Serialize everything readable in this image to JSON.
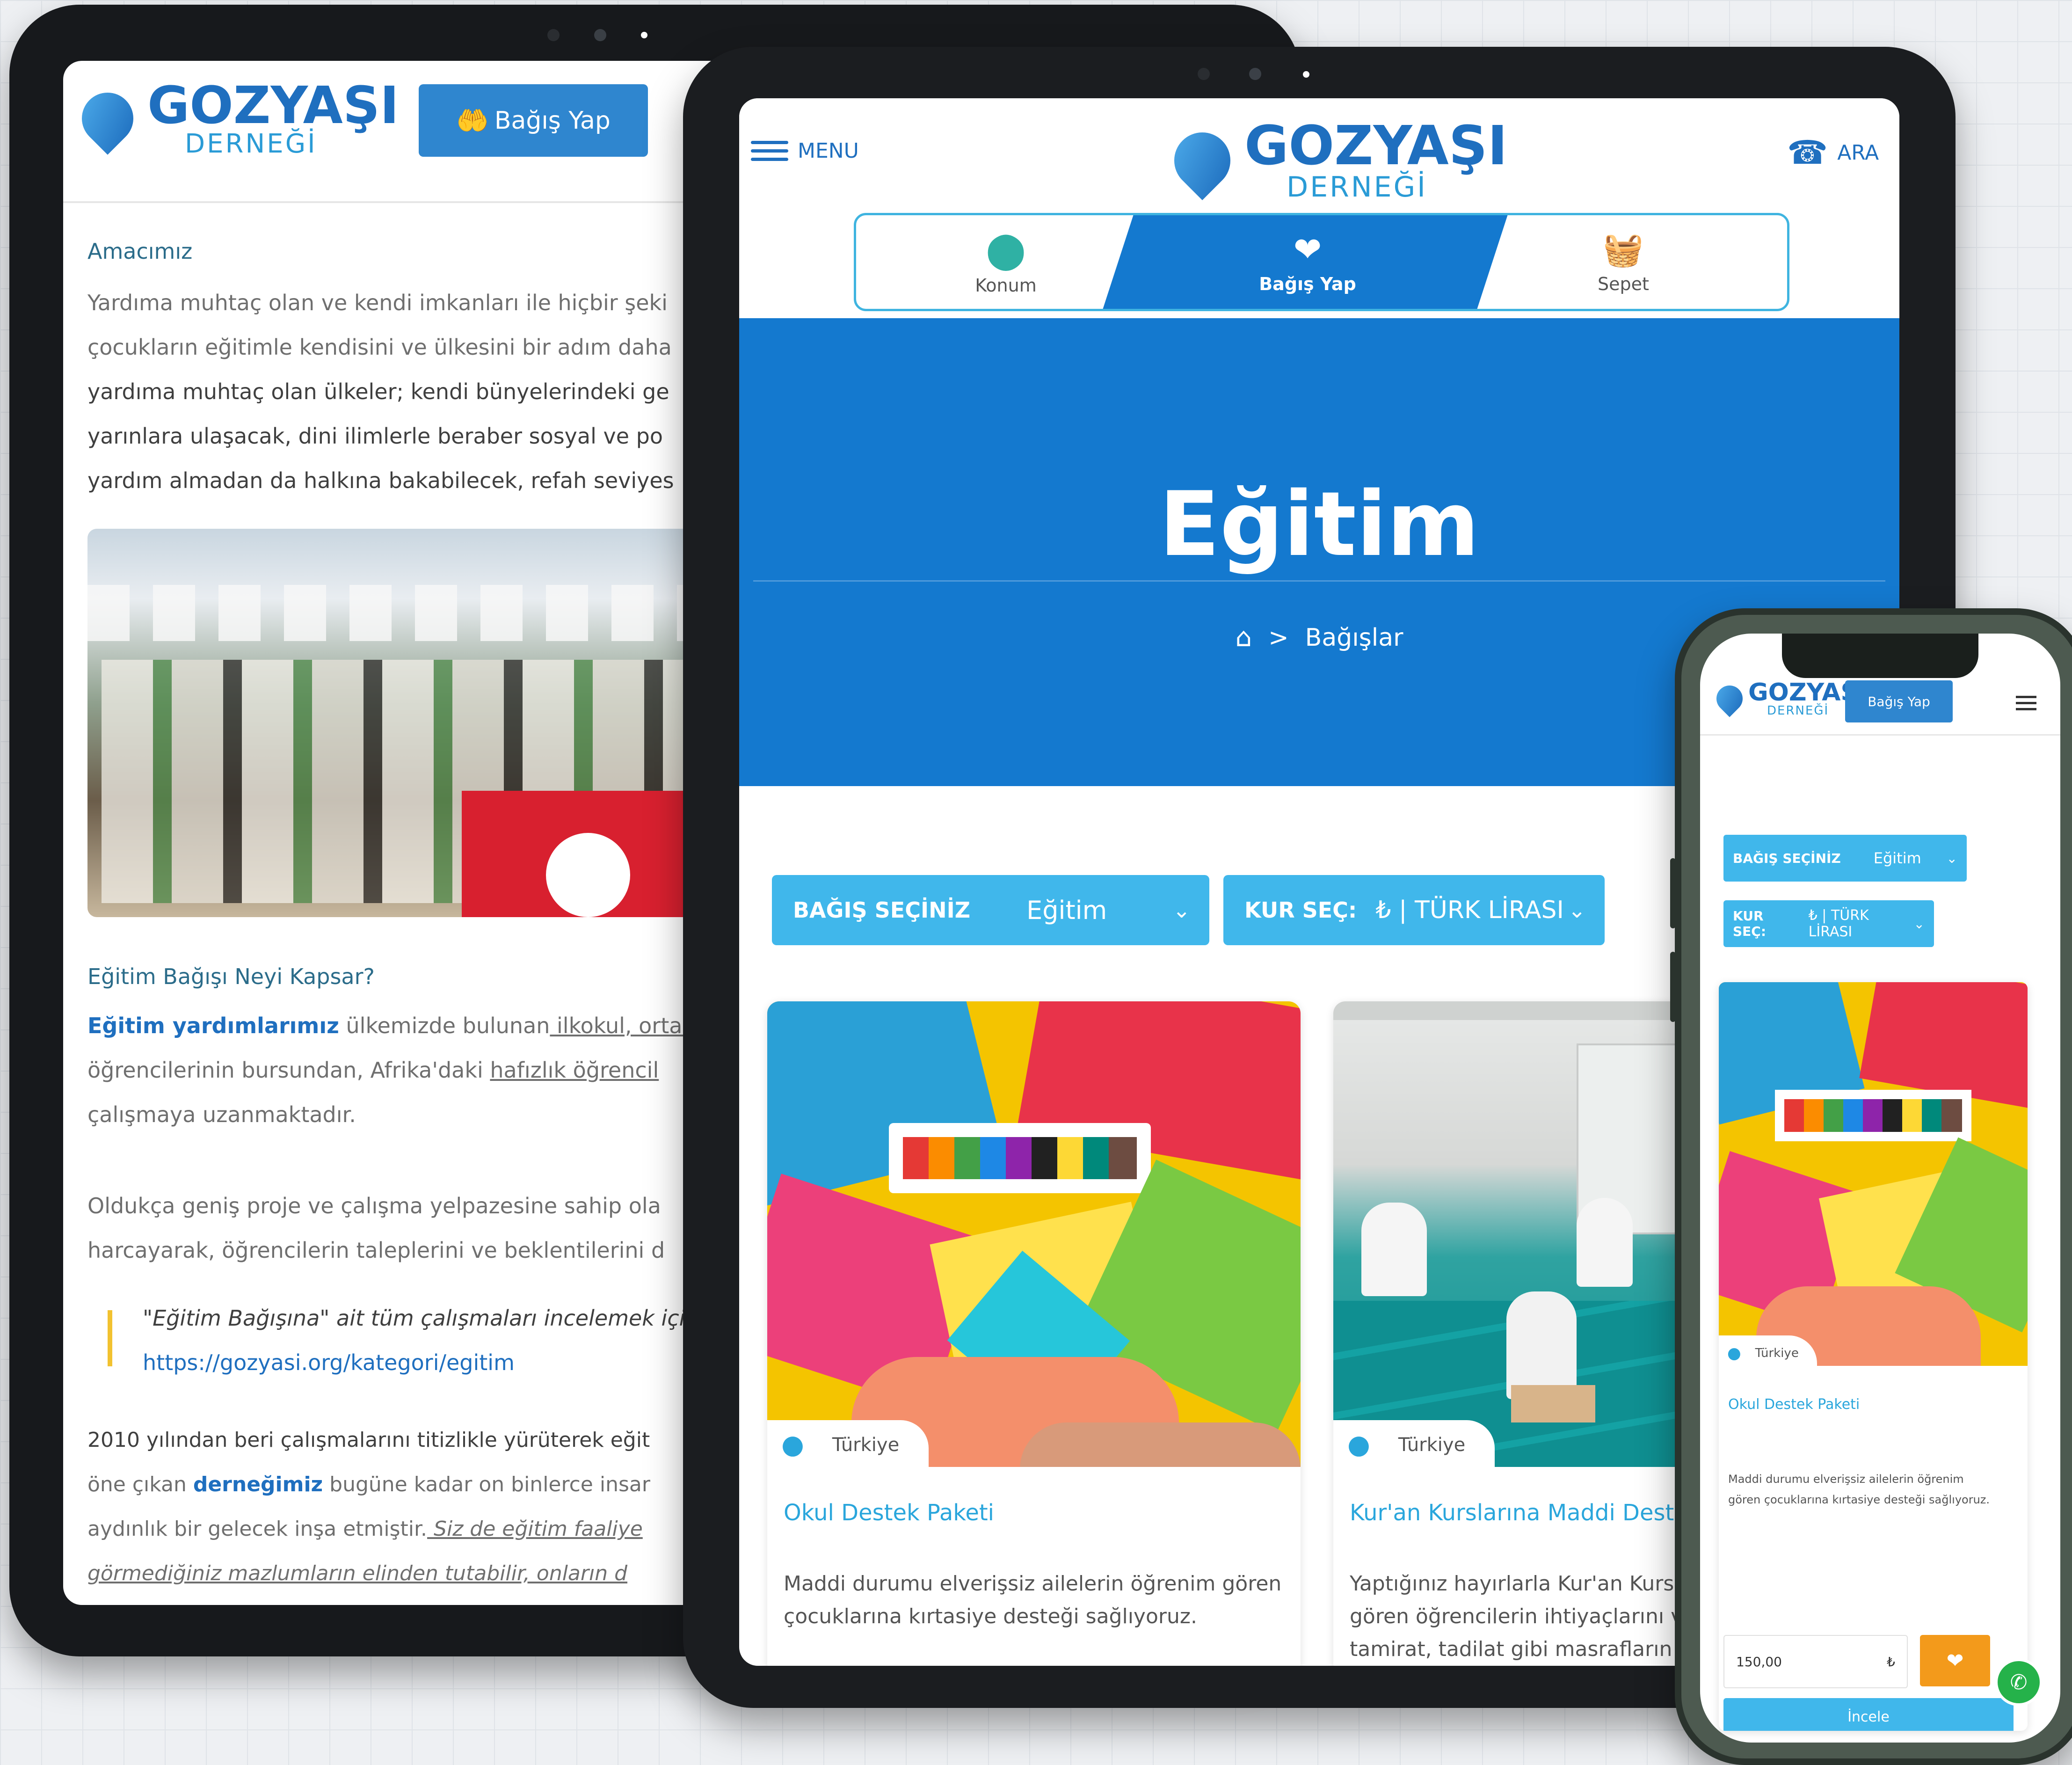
{
  "brand": {
    "name": "GOZYAŞI",
    "sub": "DERNEĞİ"
  },
  "colors": {
    "primary": "#1479cf",
    "accent": "#40b7eb",
    "link": "#2aa6dc",
    "orange": "#f39a1b",
    "quote_bar": "#f2c230"
  },
  "tablet_left": {
    "donate_button": "Bağış Yap",
    "heading_aim": "Amacımız",
    "aim_lines": [
      "Yardıma muhtaç olan ve kendi imkanları ile hiçbir şeki",
      "çocukların eğitimle kendisini ve ülkesini bir adım daha",
      "yardıma muhtaç olan ülkeler; kendi bünyelerindeki ge",
      "yarınlara ulaşacak, dini ilimlerle beraber sosyal ve po",
      "yardım almadan da halkına bakabilecek, refah seviyes"
    ],
    "heading_scope": "Eğitim Bağışı Neyi Kapsar?",
    "scope_lines": {
      "l1_bold": "Eğitim yardımlarımız",
      "l1_rest": " ülkemizde bulunan",
      "l1_link": " ilkokul, ortao",
      "l2_start": "öğrencilerinin bursundan, Afrika'daki ",
      "l2_link": "hafızlık öğrencil",
      "l3": "çalışmaya uzanmaktadır."
    },
    "para2_lines": [
      "Oldukça geniş proje ve çalışma yelpazesine sahip ola",
      "harcayarak, öğrencilerin taleplerini ve beklentilerini d"
    ],
    "quote_text": "\"Eğitim Bağışına\" ait tüm çalışmaları incelemek içi",
    "quote_link": "https://gozyasi.org/kategori/egitim",
    "para3_l1": "2010 yılından beri çalışmalarını titizlikle yürüterek eğit",
    "para3_l2_start": "öne çıkan ",
    "para3_l2_bold": "derneğimiz",
    "para3_l2_rest": " bugüne kadar on binlerce insar",
    "para3_l3_start": "aydınlık bir gelecek inşa etmiştir.",
    "para3_l3_link": " Siz de eğitim faaliye",
    "para3_l4_link": "görmediğiniz mazlumların elinden tutabilir, onların d"
  },
  "tablet_center": {
    "menu_label": "MENU",
    "call_label": "ARA",
    "tabs": [
      {
        "label": "Konum",
        "icon": "location-pin-icon"
      },
      {
        "label": "Bağış Yap",
        "icon": "donate-hand-icon"
      },
      {
        "label": "Sepet",
        "icon": "basket-icon"
      }
    ],
    "hero_title": "Eğitim",
    "breadcrumb_sep": ">",
    "breadcrumb_current": "Bağışlar",
    "donation_select_label": "BAĞIŞ SEÇİNİZ",
    "donation_select_value": "Eğitim",
    "currency_select_label": "KUR SEÇ:",
    "currency_select_value": "₺ | TÜRK LİRASI",
    "cards": [
      {
        "location": "Türkiye",
        "title": "Okul Destek Paketi",
        "text_l1": "Maddi durumu elverişsiz ailelerin öğrenim gören",
        "text_l2": "çocuklarına kırtasiye desteği sağlıyoruz."
      },
      {
        "location": "Türkiye",
        "title": "Kur'an Kurslarına Maddi Deste",
        "text_l1": "Yaptığınız hayırlarla Kur'an Kursla",
        "text_l2": "gören öğrencilerin ihtiyaçlarını v",
        "text_l3": "tamirat, tadilat gibi masrafların"
      }
    ]
  },
  "phone": {
    "donate_button": "Bağış Yap",
    "donation_select_label": "BAĞIŞ SEÇİNİZ",
    "donation_select_value": "Eğitim",
    "currency_select_label": "KUR SEÇ:",
    "currency_select_value": "₺ | TÜRK LİRASI",
    "card_location": "Türkiye",
    "card_title": "Okul Destek Paketi",
    "card_text_l1": "Maddi durumu elverişsiz ailelerin öğrenim",
    "card_text_l2": "gören çocuklarına kırtasiye desteği sağlıyoruz.",
    "amount_value": "150,00",
    "currency_symbol": "₺",
    "review_button": "İncele"
  }
}
